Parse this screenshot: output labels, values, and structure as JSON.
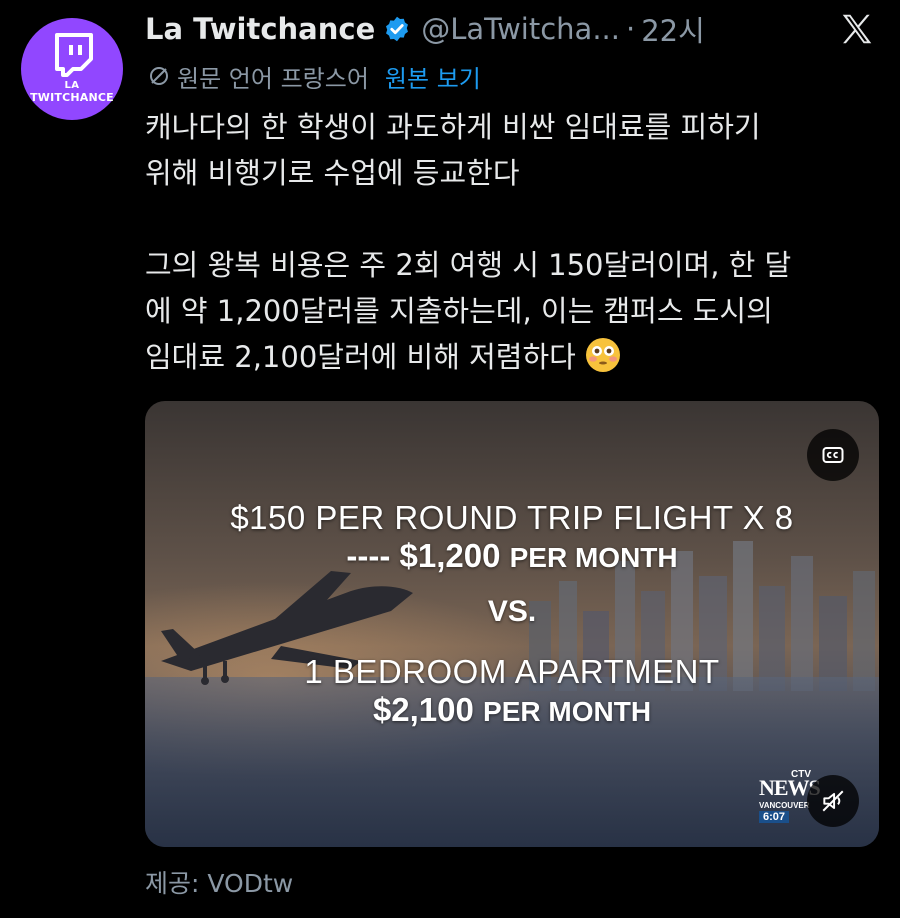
{
  "colors": {
    "background": "#000000",
    "text": "#e7e9ea",
    "muted": "#8b98a5",
    "link": "#1d9bf0",
    "avatar_bg": "#9147ff",
    "verified": "#1d9bf0"
  },
  "author": {
    "avatar_text_line1": "LA",
    "avatar_text_line2": "TWITCHANCE",
    "display_name": "La Twitchance",
    "handle": "@LaTwitcha...",
    "separator": "·",
    "time": "22시"
  },
  "translation": {
    "source_language_text": "원문 언어 프랑스어",
    "show_original_label": "원본 보기"
  },
  "tweet": {
    "paragraph1_line1": "캐나다의 한 학생이 과도하게 비싼 임대료를 피하기",
    "paragraph1_line2": "위해 비행기로 수업에 등교한다",
    "paragraph2_line1": "그의 왕복 비용은 주 2회 여행 시 150달러이며, 한 달",
    "paragraph2_line2": "에 약 1,200달러를 지출하는데, 이는 캠퍼스 도시의",
    "paragraph2_line3": "임대료 2,100달러에 비해 저렴하다",
    "emoji_name": "flushed-face"
  },
  "media": {
    "overlay_line1": "$150 PER ROUND TRIP FLIGHT X 8",
    "overlay_line2_prefix": "---- $1,200",
    "overlay_line2_suffix": "PER MONTH",
    "overlay_line3": "VS.",
    "overlay_line4": "1 BEDROOM APARTMENT",
    "overlay_line5_prefix": "$2,100",
    "overlay_line5_suffix": "PER MONTH",
    "news_logo_top": "CTV",
    "news_logo_main": "NEWS",
    "news_logo_city": "VANCOUVER",
    "news_logo_time": "6:07",
    "cc_icon": "closed-captions-icon",
    "mute_icon": "speaker-muted-icon"
  },
  "footer": {
    "source_credit": "제공: VODtw"
  }
}
